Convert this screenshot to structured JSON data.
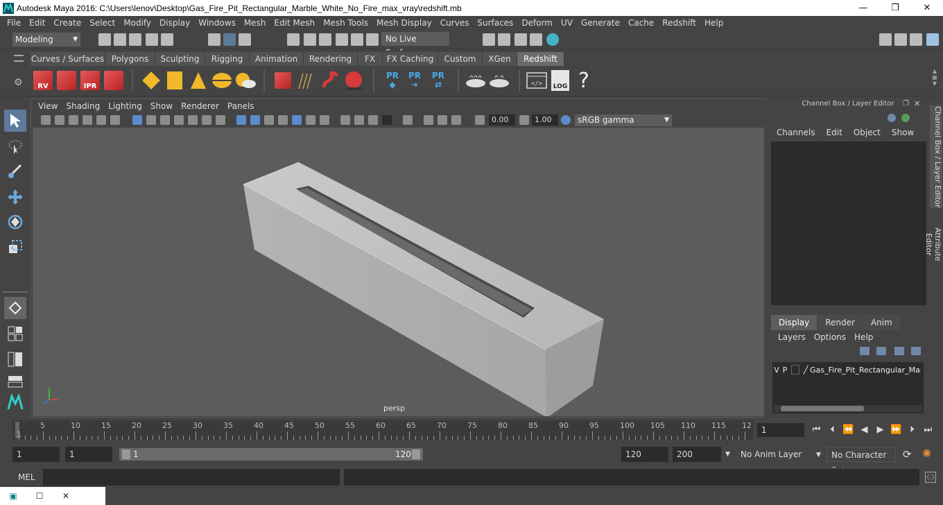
{
  "window": {
    "title": "Autodesk Maya 2016: C:\\Users\\lenov\\Desktop\\Gas_Fire_Pit_Rectangular_Marble_White_No_Fire_max_vray\\redshift.mb",
    "minimize": "—",
    "maximize": "❐",
    "close": "✕"
  },
  "menu": [
    "File",
    "Edit",
    "Create",
    "Select",
    "Modify",
    "Display",
    "Windows",
    "Mesh",
    "Edit Mesh",
    "Mesh Tools",
    "Mesh Display",
    "Curves",
    "Surfaces",
    "Deform",
    "UV",
    "Generate",
    "Cache",
    "Redshift",
    "Help"
  ],
  "status": {
    "mode": "Modeling",
    "live_surface": "No Live Surface"
  },
  "shelf_tabs": [
    "Curves / Surfaces",
    "Polygons",
    "Sculpting",
    "Rigging",
    "Animation",
    "Rendering",
    "FX",
    "FX Caching",
    "Custom",
    "XGen",
    "Redshift"
  ],
  "shelf_active": "Redshift",
  "shelf_icons": {
    "rv": "RV",
    "ipr": "IPR",
    "pr1": "PR",
    "pr2": "PR",
    "pr3": "PR",
    "log": "LOG",
    "help": "?"
  },
  "panel_menu": [
    "View",
    "Shading",
    "Lighting",
    "Show",
    "Renderer",
    "Panels"
  ],
  "panel_toolbar": {
    "exposure": "0.00",
    "gamma_value": "1.00",
    "color_space": "sRGB gamma"
  },
  "viewport": {
    "camera_label": "persp"
  },
  "channel_box": {
    "title": "Channel Box / Layer Editor",
    "menu": [
      "Channels",
      "Edit",
      "Object",
      "Show"
    ],
    "layer_tabs": [
      "Display",
      "Render",
      "Anim"
    ],
    "layer_active": "Display",
    "layer_menu": [
      "Layers",
      "Options",
      "Help"
    ],
    "layer_row": {
      "v": "V",
      "p": "P",
      "name": "Gas_Fire_Pit_Rectangular_Marb"
    }
  },
  "side_tabs": [
    "Channel Box / Layer Editor",
    "Attribute Editor"
  ],
  "timeline": {
    "ticks": [
      "5",
      "10",
      "15",
      "20",
      "25",
      "30",
      "35",
      "40",
      "45",
      "50",
      "55",
      "60",
      "65",
      "70",
      "75",
      "80",
      "85",
      "90",
      "95",
      "100",
      "105",
      "110",
      "115",
      "12"
    ],
    "start_marker": "1",
    "current_frame": "1"
  },
  "range": {
    "start": "1",
    "playback_start": "1",
    "slider_left": "1",
    "slider_right": "120",
    "playback_end": "120",
    "end": "200",
    "anim_layer": "No Anim Layer",
    "character_set": "No Character Set"
  },
  "command": {
    "label": "MEL"
  },
  "colors": {
    "accent": "#5e7a9b",
    "viewport_bg": "#5c5c5c",
    "redshift_red": "#d63a3a"
  }
}
